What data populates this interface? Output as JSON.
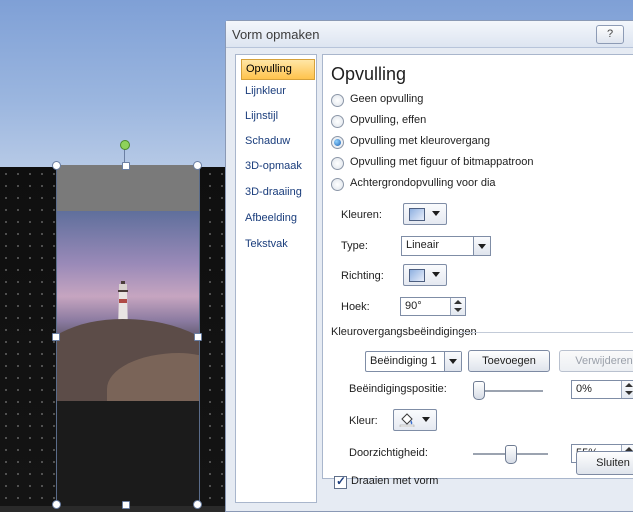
{
  "dialog": {
    "title": "Vorm opmaken",
    "help_label": "?",
    "close_label": "Sluiten"
  },
  "nav": {
    "items": [
      {
        "label": "Opvulling",
        "active": true
      },
      {
        "label": "Lijnkleur",
        "active": false
      },
      {
        "label": "Lijnstijl",
        "active": false
      },
      {
        "label": "Schaduw",
        "active": false
      },
      {
        "label": "3D-opmaak",
        "active": false
      },
      {
        "label": "3D-draaiing",
        "active": false
      },
      {
        "label": "Afbeelding",
        "active": false
      },
      {
        "label": "Tekstvak",
        "active": false
      }
    ]
  },
  "panel": {
    "title": "Opvulling",
    "radios": [
      {
        "label": "Geen opvulling",
        "checked": false
      },
      {
        "label": "Opvulling, effen",
        "checked": false
      },
      {
        "label": "Opvulling met kleurovergang",
        "checked": true
      },
      {
        "label": "Opvulling met figuur of bitmappatroon",
        "checked": false
      },
      {
        "label": "Achtergrondopvulling voor dia",
        "checked": false
      }
    ],
    "colors_label": "Kleuren:",
    "type_label": "Type:",
    "type_value": "Lineair",
    "direction_label": "Richting:",
    "angle_label": "Hoek:",
    "angle_value": "90°",
    "stops_group_label": "Kleurovergangsbeëindigingen",
    "stop_select_value": "Beëindiging 1",
    "add_button": "Toevoegen",
    "remove_button": "Verwijderen",
    "stop_position_label": "Beëindigingspositie:",
    "stop_position_value": "0%",
    "stop_position_fraction": 0.0,
    "color_label": "Kleur:",
    "transparency_label": "Doorzichtigheid:",
    "transparency_value": "55%",
    "transparency_fraction": 0.55,
    "rotate_with_shape_label": "Draaien met vorm",
    "rotate_with_shape_checked": true
  },
  "colors": {
    "nav_active": "#ffc34d",
    "selection_handle": "#ffffff",
    "rotation_handle": "#8ed25a"
  }
}
